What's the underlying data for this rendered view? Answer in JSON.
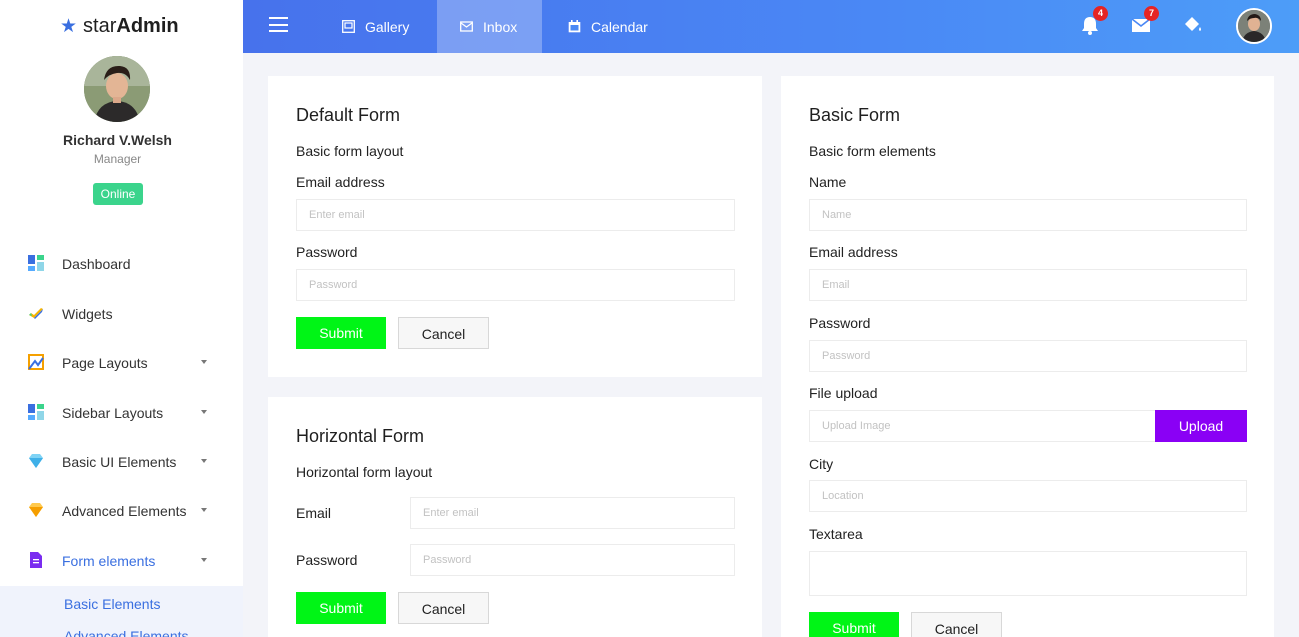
{
  "brand": {
    "part1": "star",
    "part2": "Admin"
  },
  "user": {
    "name": "Richard V.Welsh",
    "role": "Manager",
    "status": "Online"
  },
  "sidebar": {
    "items": [
      {
        "label": "Dashboard",
        "icon": "dashboard-icon",
        "has_caret": false
      },
      {
        "label": "Widgets",
        "icon": "widgets-icon",
        "has_caret": false
      },
      {
        "label": "Page Layouts",
        "icon": "page-layouts-icon",
        "has_caret": true
      },
      {
        "label": "Sidebar Layouts",
        "icon": "sidebar-layouts-icon",
        "has_caret": true
      },
      {
        "label": "Basic UI Elements",
        "icon": "diamond-icon",
        "has_caret": true
      },
      {
        "label": "Advanced Elements",
        "icon": "gem-icon",
        "has_caret": true
      },
      {
        "label": "Form elements",
        "icon": "document-icon",
        "has_caret": true
      }
    ],
    "sub_items": [
      {
        "label": "Basic Elements"
      },
      {
        "label": "Advanced Elements"
      }
    ]
  },
  "topbar": {
    "nav": [
      {
        "label": "Gallery",
        "icon": "image-icon"
      },
      {
        "label": "Inbox",
        "icon": "mail-icon",
        "active": true
      },
      {
        "label": "Calendar",
        "icon": "calendar-icon"
      }
    ],
    "notifications_count": "4",
    "messages_count": "7"
  },
  "default_form": {
    "title": "Default Form",
    "description": "Basic form layout",
    "email_label": "Email address",
    "email_placeholder": "Enter email",
    "password_label": "Password",
    "password_placeholder": "Password",
    "submit_label": "Submit",
    "cancel_label": "Cancel"
  },
  "horizontal_form": {
    "title": "Horizontal Form",
    "description": "Horizontal form layout",
    "email_label": "Email",
    "email_placeholder": "Enter email",
    "password_label": "Password",
    "password_placeholder": "Password",
    "submit_label": "Submit",
    "cancel_label": "Cancel"
  },
  "basic_form": {
    "title": "Basic Form",
    "description": "Basic form elements",
    "name_label": "Name",
    "name_placeholder": "Name",
    "email_label": "Email address",
    "email_placeholder": "Email",
    "password_label": "Password",
    "password_placeholder": "Password",
    "file_label": "File upload",
    "file_placeholder": "Upload Image",
    "upload_label": "Upload",
    "city_label": "City",
    "city_placeholder": "Location",
    "textarea_label": "Textarea",
    "submit_label": "Submit",
    "cancel_label": "Cancel"
  },
  "colors": {
    "accent": "#3a6fe0",
    "submit": "#00f516",
    "upload": "#8a00f5",
    "online": "#3bd48c",
    "badge": "#e52424"
  }
}
